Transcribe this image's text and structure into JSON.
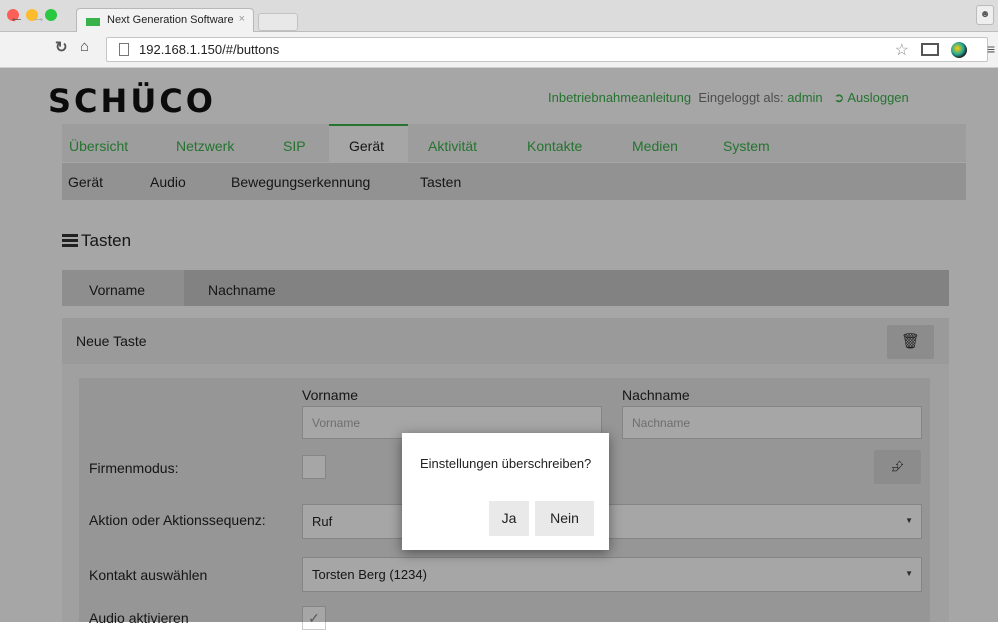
{
  "browser": {
    "tab_title": "Next Generation Software",
    "tab_close": "×",
    "url": "192.168.1.150/#/buttons"
  },
  "brand": {
    "logo": "SCHÜCO",
    "accent": "#39b24a"
  },
  "header": {
    "guide_link": "Inbetriebnahmeanleitung",
    "logged_in_label": "Eingeloggt als:",
    "user": "admin",
    "logout": "Ausloggen"
  },
  "main_nav": [
    "Übersicht",
    "Netzwerk",
    "SIP",
    "Gerät",
    "Aktivität",
    "Kontakte",
    "Medien",
    "System"
  ],
  "main_nav_active": "Gerät",
  "sub_nav": [
    "Gerät",
    "Audio",
    "Bewegungserkennung",
    "Tasten"
  ],
  "section": {
    "title": "Tasten"
  },
  "table": {
    "columns": [
      "Vorname",
      "Nachname"
    ]
  },
  "panel": {
    "title": "Neue Taste"
  },
  "form": {
    "vorname_label": "Vorname",
    "vorname_placeholder": "Vorname",
    "nachname_label": "Nachname",
    "nachname_placeholder": "Nachname",
    "firmenmodus_label": "Firmenmodus:",
    "aktion_label": "Aktion oder Aktionssequenz:",
    "aktion_value": "Ruf",
    "kontakt_label": "Kontakt auswählen",
    "kontakt_value": "Torsten Berg (1234)",
    "audio_label": "Audio aktivieren"
  },
  "dialog": {
    "message": "Einstellungen überschreiben?",
    "yes": "Ja",
    "no": "Nein"
  },
  "icons": [
    "reload-icon",
    "home-icon",
    "page-icon",
    "star-icon",
    "cast-icon",
    "extension-icon",
    "menu-icon",
    "logout-icon",
    "hamburger-icon",
    "trash-icon",
    "upload-icon",
    "caret-down-icon",
    "check-icon"
  ]
}
